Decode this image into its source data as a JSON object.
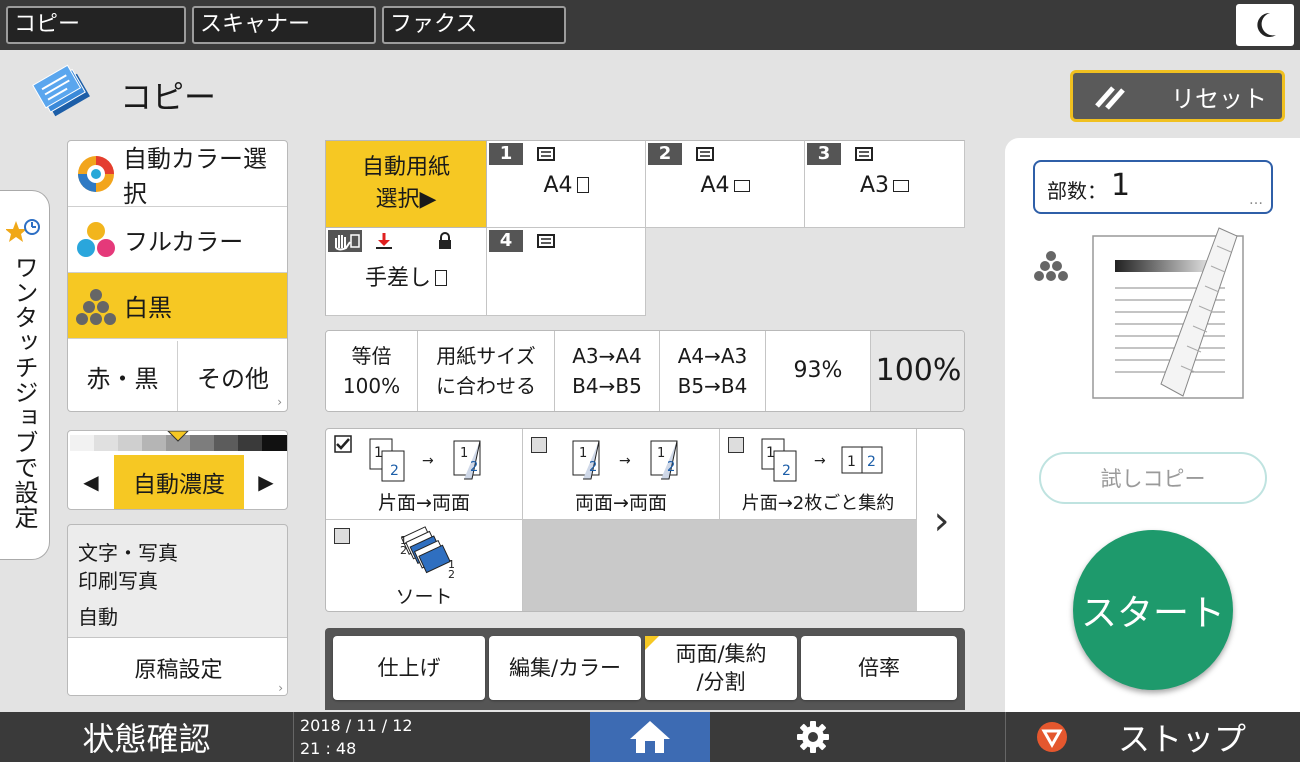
{
  "top_tabs": [
    "コピー",
    "スキャナー",
    "ファクス"
  ],
  "header": {
    "title": "コピー",
    "reset_label": "リセット"
  },
  "side_tab": {
    "label": "ワンタッチジョブで設定"
  },
  "color_mode": {
    "auto_color": "自動カラー選択",
    "full_color": "フルカラー",
    "black_white": "白黒",
    "red_black": "赤・黒",
    "other": "その他"
  },
  "density": {
    "label": "自動濃度"
  },
  "original": {
    "line1": "文字・写真",
    "line2": "印刷写真",
    "line3": "自動",
    "button": "原稿設定"
  },
  "paper": {
    "auto_line1": "自動用紙",
    "auto_line2": "選択▶",
    "bypass_label": "手差し",
    "trays": [
      {
        "num": "1",
        "size": "A4"
      },
      {
        "num": "2",
        "size": "A4"
      },
      {
        "num": "3",
        "size": "A3"
      },
      {
        "num": "4",
        "size": ""
      }
    ]
  },
  "ratio": {
    "same_line1": "等倍",
    "same_line2": "100%",
    "fit_line1": "用紙サイズ",
    "fit_line2": "に合わせる",
    "r1_line1": "A3→A4",
    "r1_line2": "B4→B5",
    "r2_line1": "A4→A3",
    "r2_line2": "B5→B4",
    "p93": "93%",
    "current": "100%"
  },
  "duplex": {
    "d1": "片面→両面",
    "d2": "両面→両面",
    "d3": "片面→2枚ごと集約",
    "sort": "ソート"
  },
  "function_tabs": {
    "finish": "仕上げ",
    "edit": "編集/カラー",
    "duplex_line1": "両面/集約",
    "duplex_line2": "/分割",
    "ratio": "倍率"
  },
  "right_panel": {
    "copies_label": "部数：",
    "copies_value": "1",
    "copies_more": "…",
    "trial_label": "試しコピー",
    "start_label": "スタート"
  },
  "bottom": {
    "status_label": "状態確認",
    "date": "2018 / 11 / 12",
    "time": "21 : 48",
    "stop_label": "ストップ"
  },
  "colors": {
    "accent": "#f6c823",
    "start": "#1e9a6c",
    "home": "#3d6bb3",
    "stop": "#e4572e"
  }
}
